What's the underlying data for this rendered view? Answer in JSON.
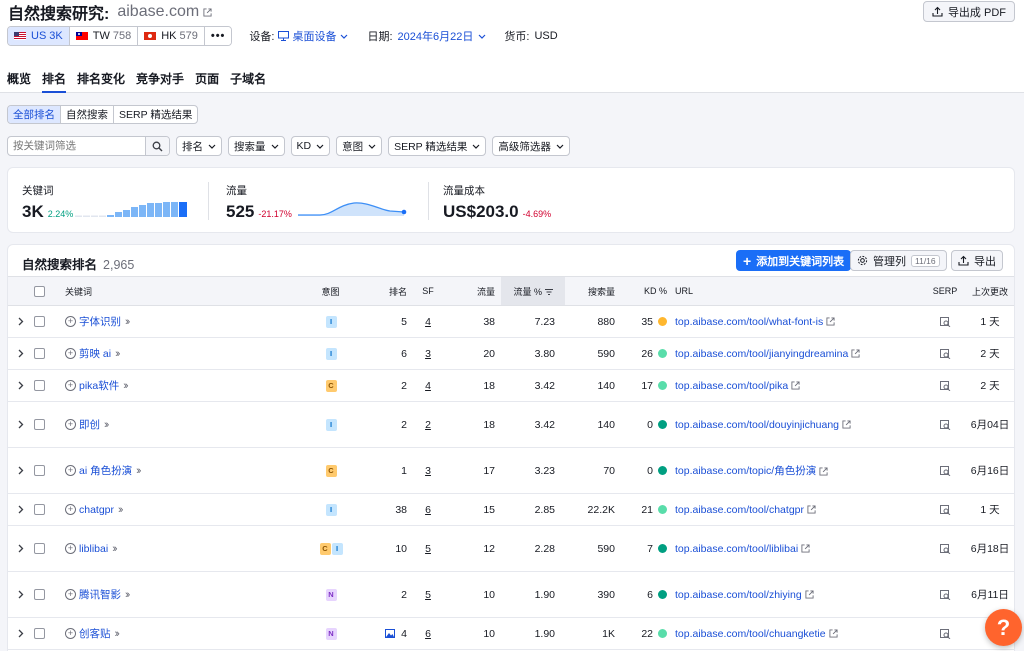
{
  "header": {
    "title": "自然搜索研究:",
    "domain": "aibase.com",
    "export_pdf_label": "导出成 PDF"
  },
  "databases": [
    {
      "code": "US",
      "count": "3K"
    },
    {
      "code": "TW",
      "count": "758"
    },
    {
      "code": "HK",
      "count": "579"
    }
  ],
  "more_label": "•••",
  "filters_bar": {
    "device_label": "设备:",
    "device_value": "桌面设备",
    "date_label": "日期:",
    "date_value": "2024年6月22日",
    "currency_label": "货币:",
    "currency_value": "USD"
  },
  "tabs": [
    "概览",
    "排名",
    "排名变化",
    "竞争对手",
    "页面",
    "子域名"
  ],
  "active_tab": "排名",
  "segments": [
    "全部排名",
    "自然搜索",
    "SERP 精选结果"
  ],
  "search": {
    "placeholder": "按关键词筛选"
  },
  "dropdowns": [
    "排名",
    "搜索量",
    "KD",
    "意图",
    "SERP 精选结果",
    "高级筛选器"
  ],
  "summary": {
    "keywords": {
      "label": "关键词",
      "value": "3K",
      "change": "2.24%"
    },
    "traffic": {
      "label": "流量",
      "value": "525",
      "change": "-21.17%"
    },
    "traffic_cost": {
      "label": "流量成本",
      "value": "US$203.0",
      "change": "-4.69%"
    }
  },
  "table_panel": {
    "title": "自然搜索排名",
    "count": "2,965",
    "add_button": "添加到关键词列表",
    "manage_button": "管理列",
    "manage_count": "11/16",
    "export_button": "导出"
  },
  "columns": {
    "keyword": "关键词",
    "intent": "意图",
    "position": "排名",
    "sf": "SF",
    "traffic": "流量",
    "traffic_pct": "流量 %",
    "volume": "搜索量",
    "kd": "KD %",
    "url": "URL",
    "serp": "SERP",
    "updated": "上次更改"
  },
  "rows": [
    {
      "keyword": "字体识别",
      "intent": [
        "I"
      ],
      "position": "5",
      "sf": "4",
      "traffic": "38",
      "traffic_pct": "7.23",
      "volume": "880",
      "kd": "35",
      "kd_color": "#ffb72e",
      "url": "top.aibase.com/tool/what-font-is",
      "updated": "1 天"
    },
    {
      "keyword": "剪映 ai",
      "intent": [
        "I"
      ],
      "position": "6",
      "sf": "3",
      "traffic": "20",
      "traffic_pct": "3.80",
      "volume": "590",
      "kd": "26",
      "kd_color": "#59ddaa",
      "url": "top.aibase.com/tool/jianyingdreamina",
      "updated": "2 天"
    },
    {
      "keyword": "pika软件",
      "intent": [
        "C"
      ],
      "position": "2",
      "sf": "4",
      "traffic": "18",
      "traffic_pct": "3.42",
      "volume": "140",
      "kd": "17",
      "kd_color": "#59ddaa",
      "url": "top.aibase.com/tool/pika",
      "updated": "2 天"
    },
    {
      "keyword": "即创",
      "intent": [
        "I"
      ],
      "position": "2",
      "sf": "2",
      "traffic": "18",
      "traffic_pct": "3.42",
      "volume": "140",
      "kd": "0",
      "kd_color": "#009f81",
      "url": "top.aibase.com/tool/douyinjichuang",
      "updated": "6月04日"
    },
    {
      "keyword": "ai 角色扮演",
      "intent": [
        "C"
      ],
      "position": "1",
      "sf": "3",
      "traffic": "17",
      "traffic_pct": "3.23",
      "volume": "70",
      "kd": "0",
      "kd_color": "#009f81",
      "url": "top.aibase.com/topic/角色扮演",
      "updated": "6月16日"
    },
    {
      "keyword": "chatgpr",
      "intent": [
        "I"
      ],
      "position": "38",
      "sf": "6",
      "traffic": "15",
      "traffic_pct": "2.85",
      "volume": "22.2K",
      "kd": "21",
      "kd_color": "#59ddaa",
      "url": "top.aibase.com/tool/chatgpr",
      "updated": "1 天"
    },
    {
      "keyword": "liblibai",
      "intent": [
        "C",
        "I"
      ],
      "position": "10",
      "sf": "5",
      "traffic": "12",
      "traffic_pct": "2.28",
      "volume": "590",
      "kd": "7",
      "kd_color": "#009f81",
      "url": "top.aibase.com/tool/liblibai",
      "updated": "6月18日"
    },
    {
      "keyword": "腾讯智影",
      "intent": [
        "N"
      ],
      "position": "2",
      "sf": "5",
      "traffic": "10",
      "traffic_pct": "1.90",
      "volume": "390",
      "kd": "6",
      "kd_color": "#009f81",
      "url": "top.aibase.com/tool/zhiying",
      "updated": "6月11日"
    },
    {
      "keyword": "创客贴",
      "intent": [
        "N"
      ],
      "position": "4",
      "sf": "6",
      "traffic": "10",
      "traffic_pct": "1.90",
      "volume": "1K",
      "kd": "22",
      "kd_color": "#59ddaa",
      "url": "top.aibase.com/tool/chuangketie",
      "updated": "1",
      "serp_image": true
    }
  ],
  "help_label": "?",
  "colors": {
    "accent": "#1a4fd6",
    "primary_button": "#1a6ef7",
    "help": "#ff642d",
    "up": "#009f81",
    "down": "#d1002f"
  }
}
